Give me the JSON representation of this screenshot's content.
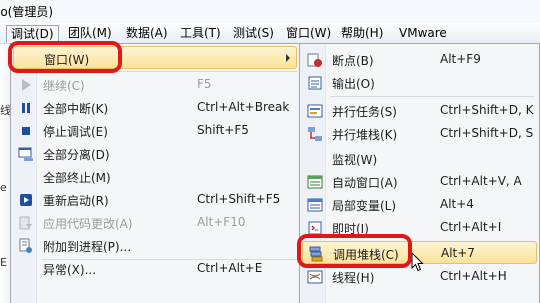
{
  "window": {
    "title": "io(管理员)"
  },
  "menubar": {
    "items": [
      {
        "label": "调试(D)"
      },
      {
        "label": "团队(M)"
      },
      {
        "label": "数据(A)"
      },
      {
        "label": "工具(T)"
      },
      {
        "label": "测试(S)"
      },
      {
        "label": "窗口(W)"
      },
      {
        "label": "帮助(H)"
      },
      {
        "label": "VMware"
      }
    ]
  },
  "background": {
    "fragments": [
      "线",
      "e",
      "E"
    ]
  },
  "debug_menu": {
    "items": [
      {
        "label": "窗口(W)",
        "shortcut": "",
        "icon": "none",
        "disabled": false,
        "submenu": true
      },
      {
        "label": "继续(C)",
        "shortcut": "F5",
        "icon": "play-icon",
        "disabled": true
      },
      {
        "label": "全部中断(K)",
        "shortcut": "Ctrl+Alt+Break",
        "icon": "pause-icon",
        "disabled": false
      },
      {
        "label": "停止调试(E)",
        "shortcut": "Shift+F5",
        "icon": "stop-icon",
        "disabled": false
      },
      {
        "label": "全部分离(D)",
        "shortcut": "",
        "icon": "detach-icon",
        "disabled": false
      },
      {
        "label": "全部终止(M)",
        "shortcut": "",
        "icon": "none",
        "disabled": false
      },
      {
        "label": "重新启动(R)",
        "shortcut": "Ctrl+Shift+F5",
        "icon": "restart-icon",
        "disabled": false
      },
      {
        "label": "应用代码更改(A)",
        "shortcut": "Alt+F10",
        "icon": "apply-code-icon",
        "disabled": true
      },
      {
        "label": "附加到进程(P)...",
        "shortcut": "",
        "icon": "attach-icon",
        "disabled": false
      },
      {
        "label": "异常(X)...",
        "shortcut": "Ctrl+Alt+E",
        "icon": "none",
        "disabled": false
      }
    ]
  },
  "windows_submenu": {
    "items": [
      {
        "label": "断点(B)",
        "shortcut": "Alt+F9",
        "icon": "breakpoints-icon"
      },
      {
        "label": "输出(O)",
        "shortcut": "",
        "icon": "output-icon"
      },
      {
        "label": "并行任务(S)",
        "shortcut": "Ctrl+Shift+D, K",
        "icon": "parallel-tasks-icon"
      },
      {
        "label": "并行堆栈(K)",
        "shortcut": "Ctrl+Shift+D, S",
        "icon": "parallel-stacks-icon"
      },
      {
        "label": "监视(W)",
        "shortcut": "",
        "icon": "none"
      },
      {
        "label": "自动窗口(A)",
        "shortcut": "Ctrl+Alt+V, A",
        "icon": "autos-icon"
      },
      {
        "label": "局部变量(L)",
        "shortcut": "Alt+4",
        "icon": "locals-icon"
      },
      {
        "label": "即时(I)",
        "shortcut": "Ctrl+Alt+I",
        "icon": "immediate-icon"
      },
      {
        "label": "调用堆栈(C)",
        "shortcut": "Alt+7",
        "icon": "call-stack-icon"
      },
      {
        "label": "线程(H)",
        "shortcut": "Ctrl+Alt+H",
        "icon": "threads-icon"
      }
    ]
  },
  "colors": {
    "highlight": "#fbe39b",
    "annotation_ring": "#e1181a",
    "menubar": "#e9eff6"
  }
}
